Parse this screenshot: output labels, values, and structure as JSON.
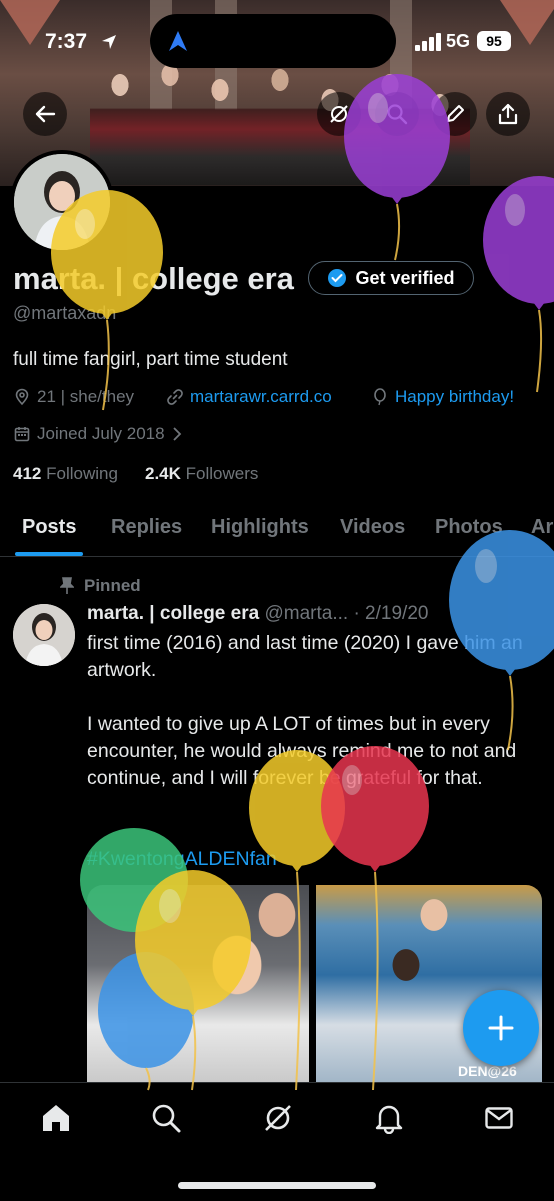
{
  "status_bar": {
    "time": "7:37",
    "network": "5G",
    "battery": "95"
  },
  "profile": {
    "name": "marta. | college era",
    "verify_label": "Get verified",
    "handle": "@martaxadn",
    "bio": "full time fangirl, part time student",
    "location": "21 | she/they",
    "website": "martarawr.carrd.co",
    "birthday": "Happy birthday!",
    "joined": "Joined July 2018",
    "following_count": "412",
    "following_label": "Following",
    "followers_count": "2.4K",
    "followers_label": "Followers"
  },
  "tabs": [
    "Posts",
    "Replies",
    "Highlights",
    "Videos",
    "Photos",
    "Ar"
  ],
  "active_tab": "Posts",
  "post": {
    "pinned_label": "Pinned",
    "author_name": "marta. | college era",
    "author_handle": "@marta...",
    "date": "· 2/19/20",
    "text": "first time (2016) and last time (2020) I gave him an artwork.\n\nI wanted to give up A LOT of times but in every encounter, he would always remind me to not and continue, and I will forever be grateful for that.",
    "hashtag": "#KwentongALDENfan",
    "media_caption": "DEN@26"
  },
  "icons": {
    "back": "back-arrow-icon",
    "grok": "grok-icon",
    "search": "search-icon",
    "edit": "edit-icon",
    "share": "share-icon",
    "verified": "verified-badge-icon",
    "location": "location-pin-icon",
    "link": "link-icon",
    "balloon": "birthday-balloon-icon",
    "calendar": "calendar-icon",
    "pin": "pin-icon",
    "compose": "plus-icon",
    "nav": [
      "home-icon",
      "search-icon",
      "grok-icon",
      "bell-icon",
      "mail-icon"
    ]
  },
  "colors": {
    "accent": "#1d9bf0",
    "background": "#000000",
    "muted": "#71767b",
    "text": "#e7e9ea"
  }
}
